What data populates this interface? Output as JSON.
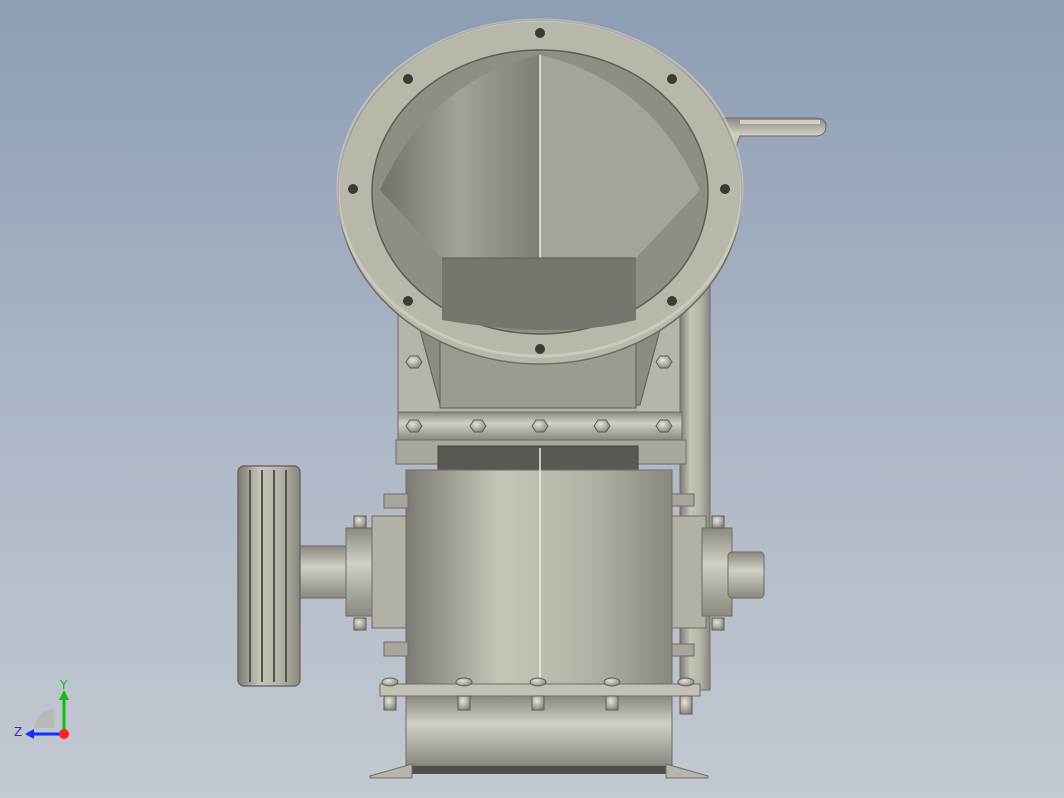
{
  "viewport": {
    "background_top": "#8d9db4",
    "background_bottom": "#c3c9d1",
    "part_color": "#b9b7aa",
    "part_shadow": "#8c8a80"
  },
  "triad": {
    "x_axis_color": "#ff2020",
    "y_axis_color": "#10c010",
    "z_axis_color": "#1030ff",
    "y_label": "Y",
    "z_label": "Z"
  }
}
